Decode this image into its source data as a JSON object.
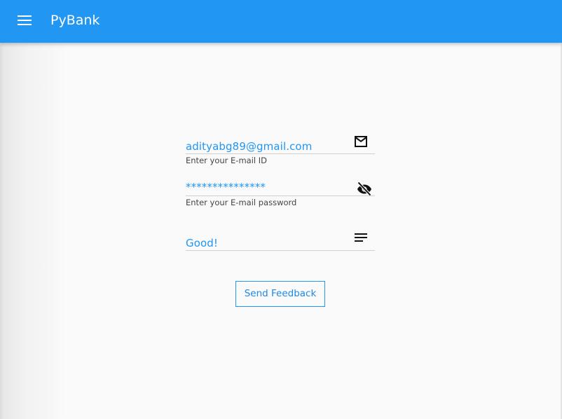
{
  "app": {
    "title": "PyBank",
    "accent_color": "#2196f3",
    "menu_icon": "hamburger-menu-icon"
  },
  "form": {
    "email": {
      "value": "adityabg89@gmail.com",
      "helper": "Enter your E-mail ID",
      "icon": "mail-icon"
    },
    "password": {
      "value": "***************",
      "helper": "Enter your E-mail password",
      "icon": "eye-off-icon"
    },
    "feedback": {
      "value": "Good!",
      "icon": "notes-icon"
    },
    "send_button_label": "Send Feedback"
  }
}
